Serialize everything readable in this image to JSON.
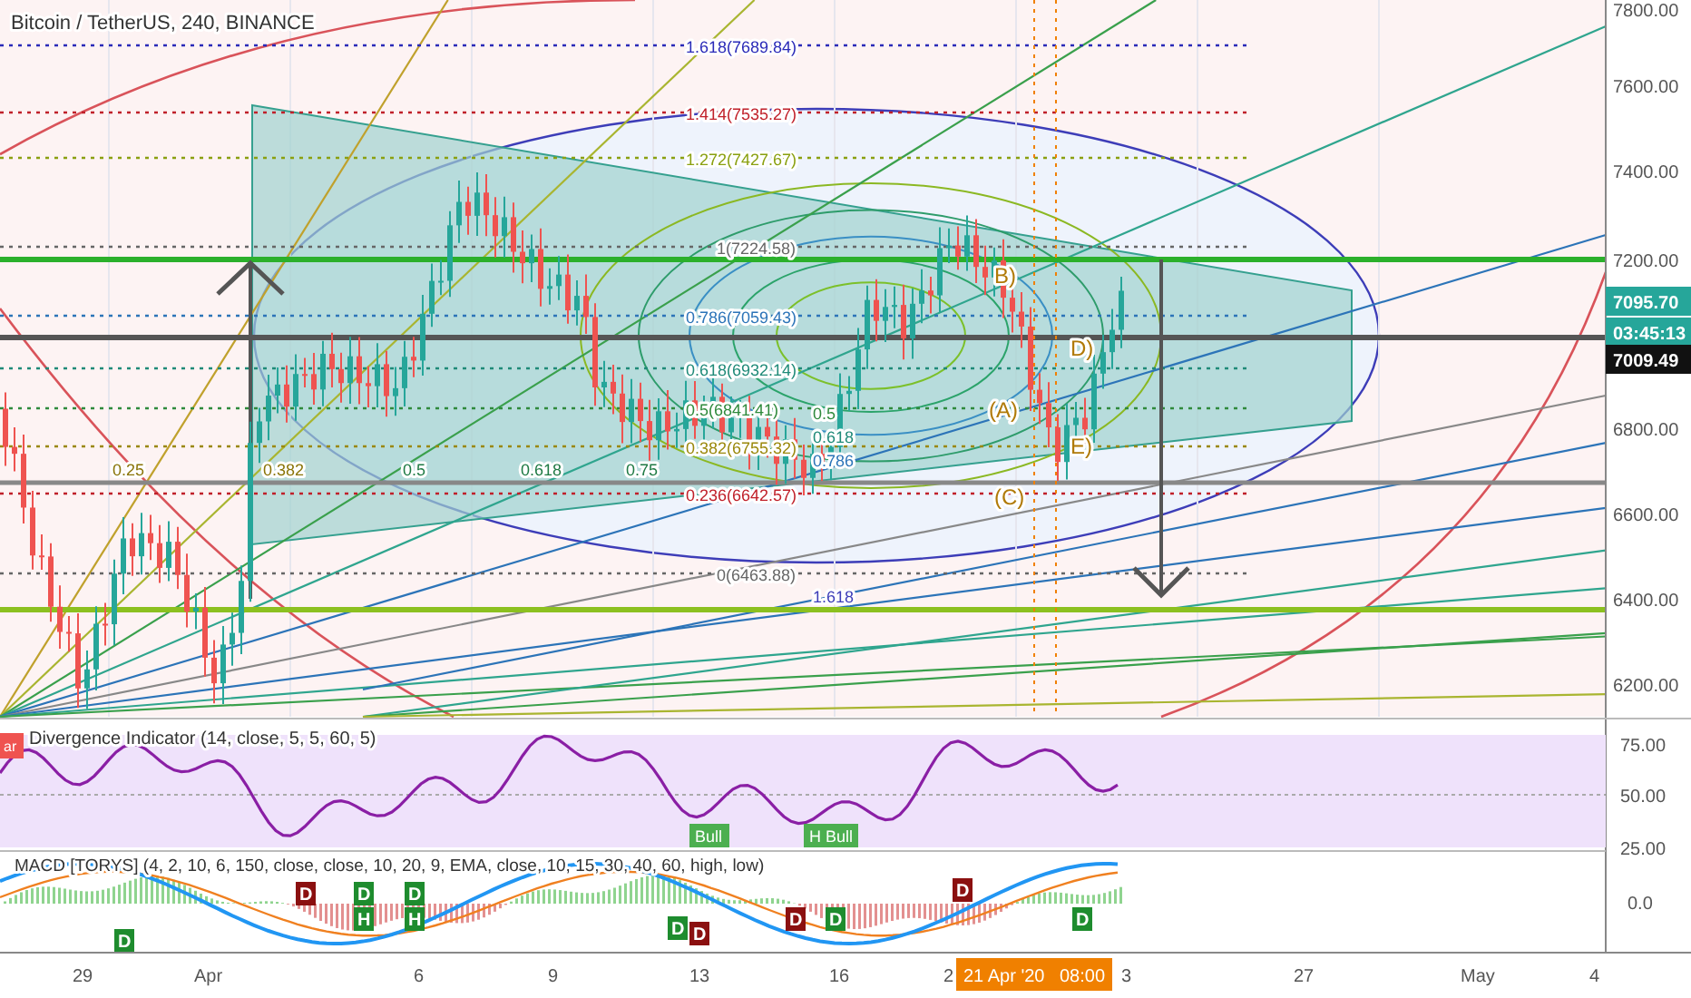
{
  "chart": {
    "title": "Bitcoin / TetherUS, 240, BINANCE",
    "fib_labels": [
      "1.618(7689.84)",
      "1.414(7535.27)",
      "1.272(7427.67)",
      "1(7224.58)",
      "0.786(7059.43)",
      "0.618(6932.14)",
      "0.5(6841.41)",
      "0.382(6755.32)",
      "0.236(6642.57)",
      "0(6463.88)"
    ],
    "fan_labels": [
      "0.25",
      "0.382",
      "0.5",
      "0.618",
      "0.75"
    ],
    "arc_labels": [
      "0.5",
      "0.618",
      "0.786",
      "1.618"
    ],
    "wave_labels": [
      "B)",
      "D)",
      "(A)",
      "E)",
      "(C)"
    ],
    "price_axis": [
      "7800.00",
      "7600.00",
      "7400.00",
      "7200.00",
      "6800.00",
      "6600.00",
      "6400.00",
      "6200.00"
    ],
    "price_tags": [
      {
        "kind": "last",
        "text": "7095.70"
      },
      {
        "kind": "countdown",
        "text": "03:45:13"
      },
      {
        "kind": "marker",
        "text": "7009.49"
      }
    ]
  },
  "rsi": {
    "title": "Divergence Indicator (14, close, 5, 5, 60, 5)",
    "flag": "ar",
    "signals": [
      "Bull",
      "H Bull"
    ],
    "axis": [
      "75.00",
      "50.00",
      "25.00"
    ]
  },
  "macd": {
    "title": "MACD [TORYS] (4, 2, 10, 6, 150, close, close, 10, 20, 9, EMA, close, 10, 15, 30, 40, 60, high, low)",
    "axis": [
      "0.0"
    ],
    "markers": [
      {
        "letter": "D",
        "color": "#1e8c2e"
      },
      {
        "letter": "D",
        "color": "#8b1010"
      },
      {
        "letter": "D",
        "color": "#1e8c2e"
      },
      {
        "letter": "H",
        "color": "#1e8c2e"
      },
      {
        "letter": "D",
        "color": "#1e8c2e"
      },
      {
        "letter": "H",
        "color": "#1e8c2e"
      },
      {
        "letter": "D",
        "color": "#1e8c2e"
      },
      {
        "letter": "D",
        "color": "#8b1010"
      },
      {
        "letter": "D",
        "color": "#8b1010"
      },
      {
        "letter": "D",
        "color": "#1e8c2e"
      },
      {
        "letter": "D",
        "color": "#8b1010"
      },
      {
        "letter": "D",
        "color": "#1e8c2e"
      }
    ]
  },
  "time_axis": {
    "labels": [
      "29",
      "Apr",
      "6",
      "9",
      "13",
      "16",
      "2",
      "3",
      "27",
      "May",
      "4"
    ],
    "crosshair_date": "21 Apr '20",
    "crosshair_time": "08:00"
  }
}
